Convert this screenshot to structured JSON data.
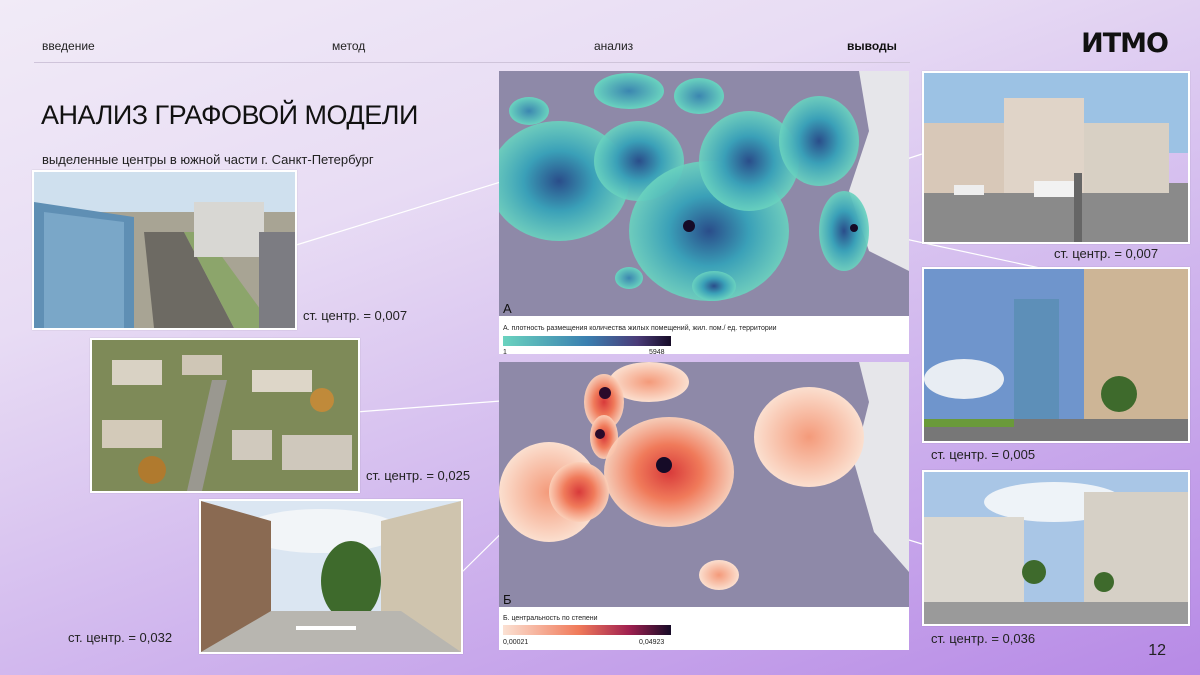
{
  "nav": [
    "введение",
    "метод",
    "анализ",
    "выводы"
  ],
  "logo": "ИТМО",
  "title": "АНАЛИЗ ГРАФОВОЙ МОДЕЛИ",
  "subtitle": "выделенные центры в южной части г. Санкт-Петербург",
  "page_number": "12",
  "captions": {
    "left_top": "ст. центр. = 0,007",
    "left_mid": "ст. центр. = 0,025",
    "left_bottom": "ст. центр. = 0,032",
    "right_top": "ст. центр. = 0,007",
    "right_mid": "ст. центр. = 0,005",
    "right_bottom": "ст. центр. = 0,036"
  },
  "map_a": {
    "letter": "А",
    "legend_title": "А. плотность размещения количества жилых помещений, жил. пом./ ед. территории",
    "legend_min": "1",
    "legend_max": "5948"
  },
  "map_b": {
    "letter": "Б",
    "legend_title": "Б. центральность по степени",
    "legend_min": "0,00021",
    "legend_max": "0,04923"
  },
  "colors": {
    "accent": "#9b6be0",
    "density_low": "#6ad3bf",
    "density_high": "#1a0f2e",
    "centrality_low": "#fbe1d3",
    "centrality_high": "#1a0f2e"
  }
}
